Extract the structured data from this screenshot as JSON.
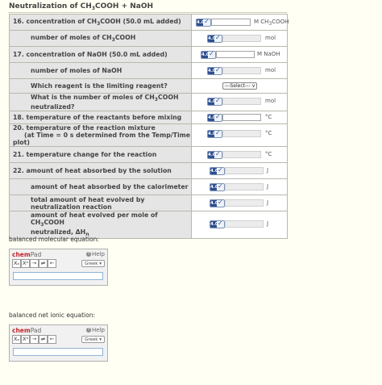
{
  "title": {
    "prefix": "Neutralization of CH",
    "sub1": "3",
    "suffix": "COOH + NaOH"
  },
  "q16": {
    "prefix": "16. concentration of CH",
    "sub": "3",
    "suffix": "COOH (50.0 mL added)",
    "unit_prefix": "M CH",
    "unit_sub": "3",
    "unit_suffix": "COOH",
    "value": ""
  },
  "q16b": {
    "prefix": "number of moles of CH",
    "sub": "3",
    "suffix": "COOH",
    "unit": "mol",
    "value": ""
  },
  "q17": {
    "label": "17. concentration of NaOH (50.0 mL added)",
    "unit": "M NaOH",
    "value": ""
  },
  "q17b": {
    "label": "number of moles of NaOH",
    "unit": "mol",
    "value": ""
  },
  "q_limiting": {
    "label": "Which reagent is the limiting reagent?",
    "select": "---Select--- ∨"
  },
  "q_neutral": {
    "prefix": "What is the number of moles of CH",
    "sub": "3",
    "suffix": "COOH neutralized?",
    "unit": "mol",
    "value": ""
  },
  "q18": {
    "label": "18. temperature of the reactants before mixing",
    "unit": "°C",
    "value": ""
  },
  "q20": {
    "line1": "20. temperature of the reaction mixture",
    "line2": "(at Time = 0 s determined from the Temp/Time plot)",
    "unit": "°C",
    "value": ""
  },
  "q21": {
    "label": "21. temperature change for the reaction",
    "unit": "°C",
    "value": ""
  },
  "q22": {
    "label": "22. amount of heat absorbed by the solution",
    "unit": "J",
    "value": ""
  },
  "q22b": {
    "label": "amount of heat absorbed by the calorimeter",
    "unit": "J",
    "value": ""
  },
  "q22c": {
    "label": "total amount of heat evolved by neutralization reaction",
    "unit": "J",
    "value": ""
  },
  "q22d": {
    "line1_prefix": "amount of heat evolved per mole of CH",
    "line1_sub": "3",
    "line1_suffix": "COOH",
    "line2_prefix": "neutralized, ΔH",
    "line2_sub": "n",
    "unit": "J",
    "value": ""
  },
  "icon_text": "4.0",
  "eq1": {
    "label": "balanced molecular equation:"
  },
  "eq2": {
    "label": "balanced net ionic equation:"
  },
  "chempad": {
    "logo_a": "chem",
    "logo_b": "Pad",
    "help": "Help",
    "greek": "Greek ▾",
    "tools": [
      "Xₐ",
      "Xᵃ",
      "→",
      "⇌",
      "←"
    ]
  },
  "colors": {
    "label_bg": "#e5e5e5",
    "brand_red": "#c3262c",
    "page_bg": "#fffff4"
  }
}
